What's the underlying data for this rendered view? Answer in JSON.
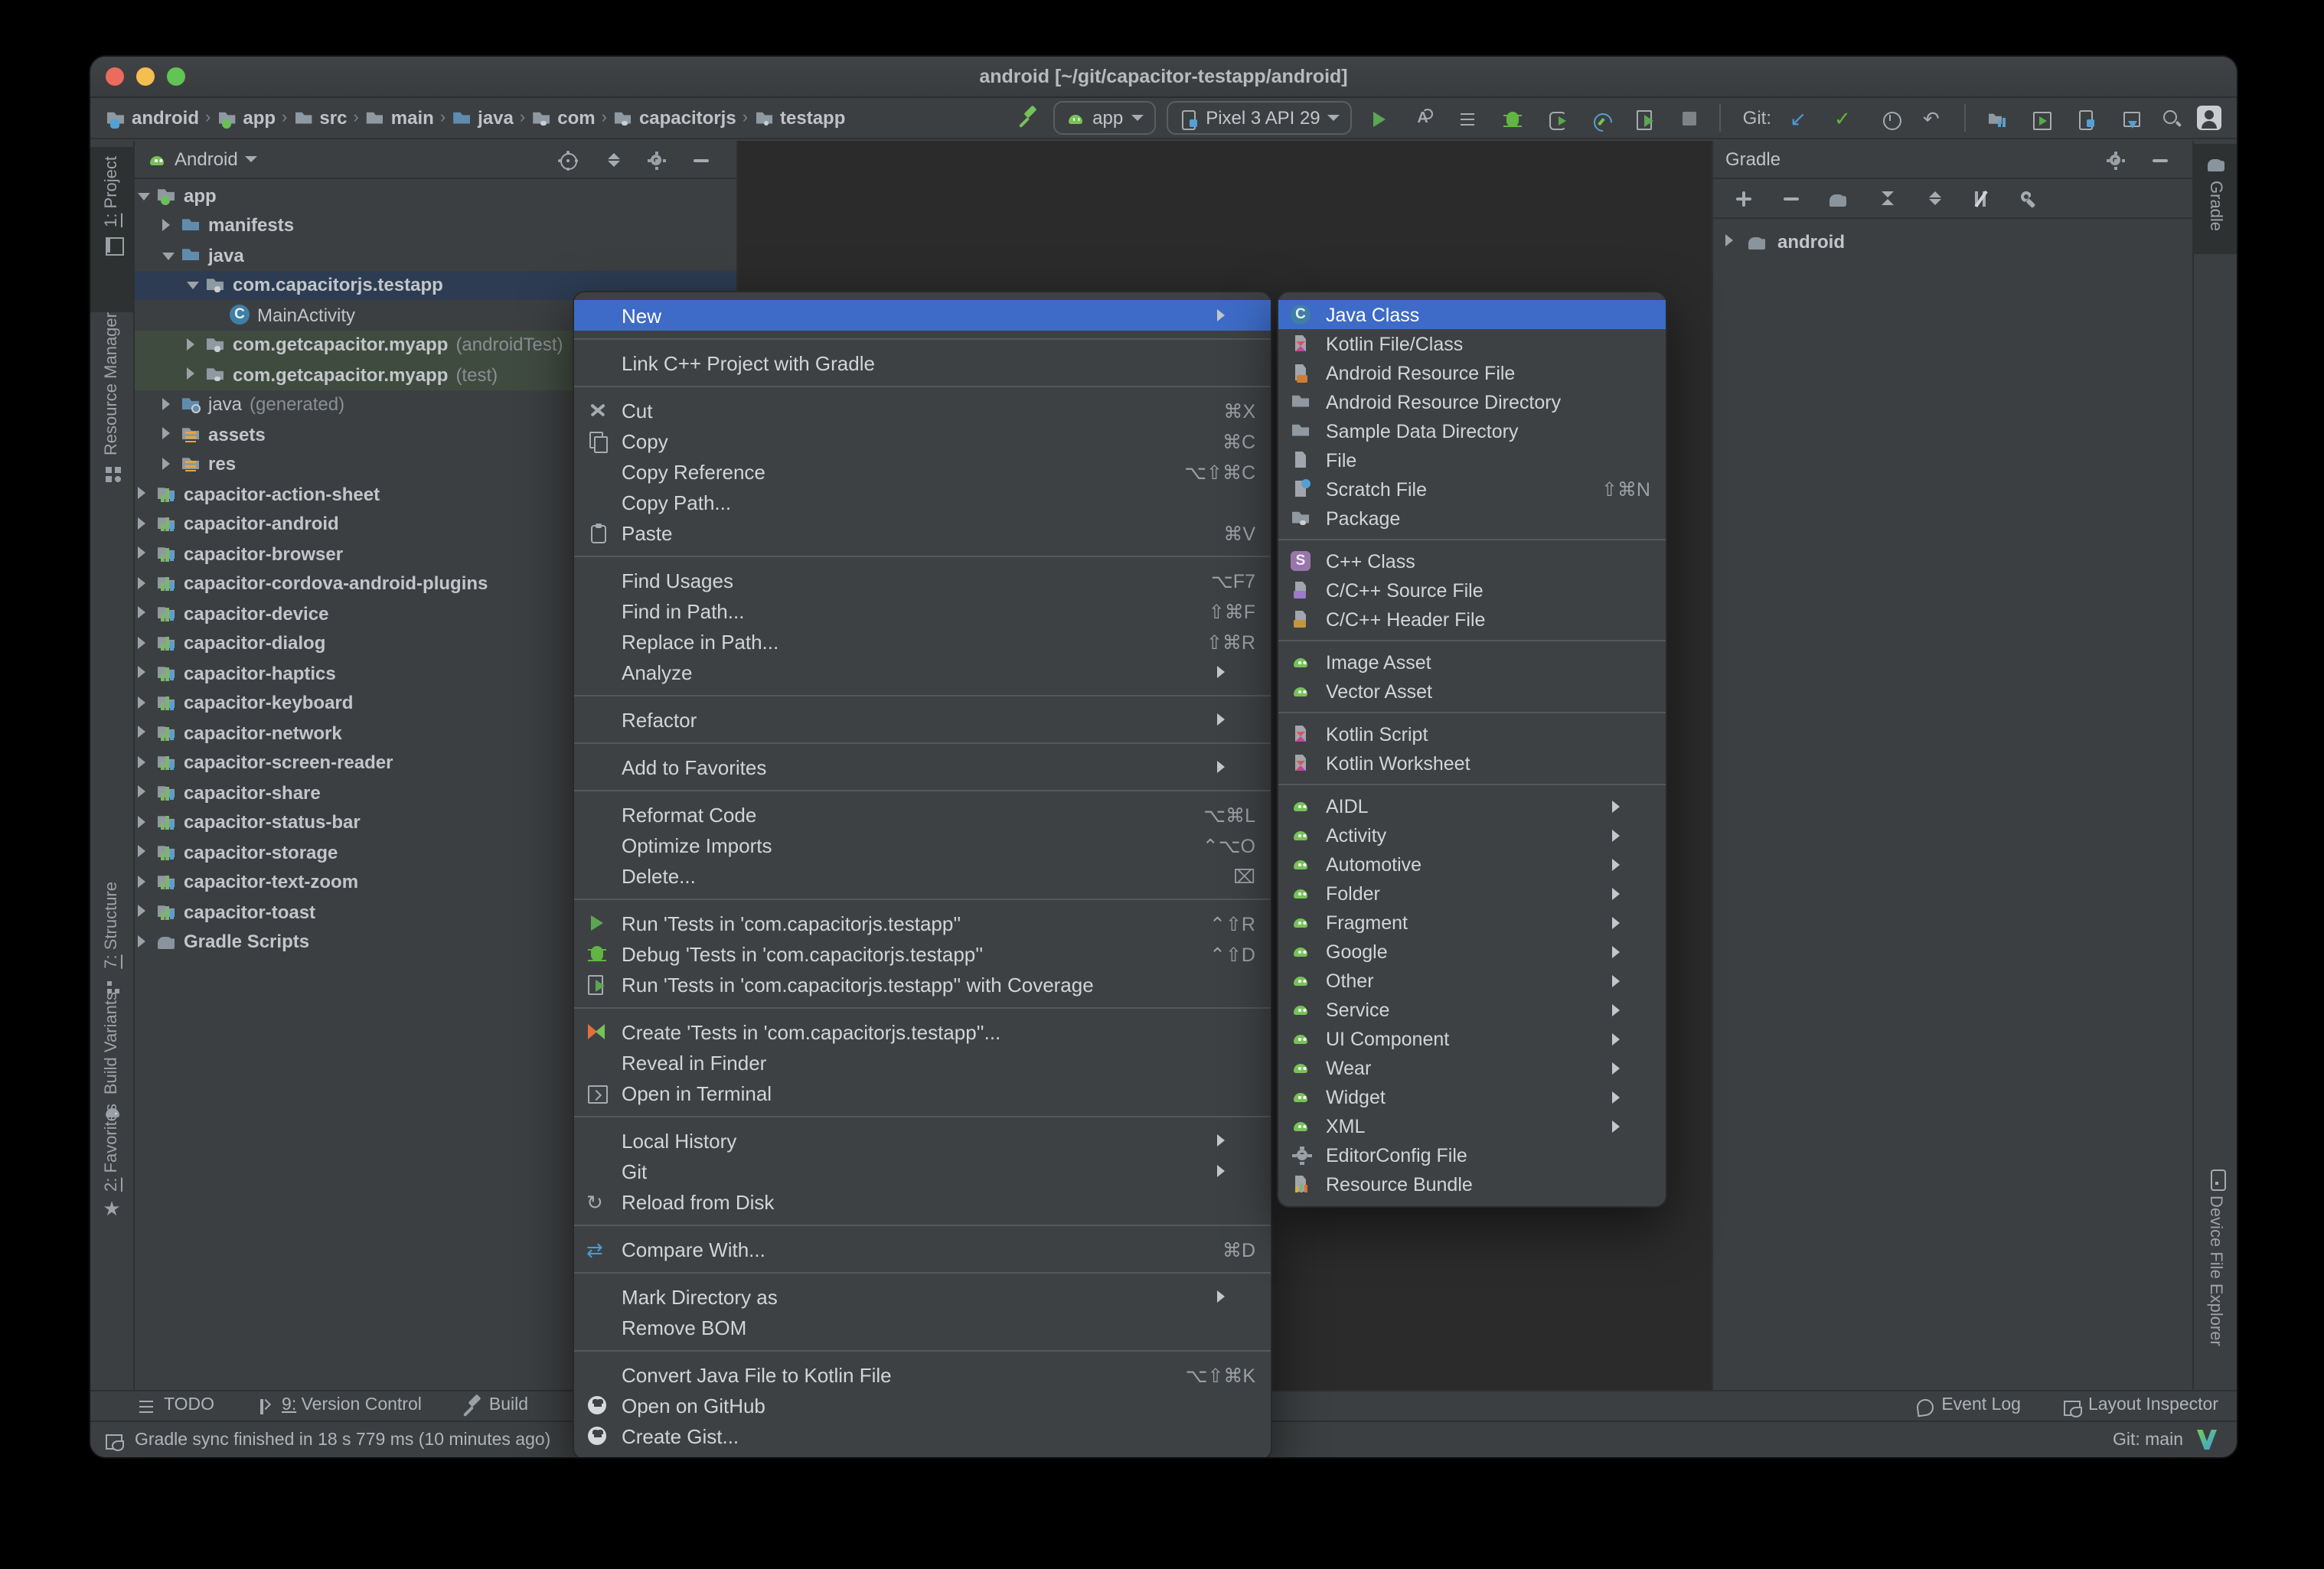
{
  "window": {
    "title": "android [~/git/capacitor-testapp/android]"
  },
  "accent_colors": {
    "selection_blue": "#3D6BC7",
    "tree_selection": "#2D3C53",
    "test_source_green": "#404B40",
    "run_green": "#5BA653",
    "android_green": "#77C159"
  },
  "toolbar": {
    "breadcrumbs": [
      {
        "label": "android",
        "icon": "android-folder"
      },
      {
        "label": "app",
        "icon": "app-folder"
      },
      {
        "label": "src",
        "icon": "folder"
      },
      {
        "label": "main",
        "icon": "folder"
      },
      {
        "label": "java",
        "icon": "fold-b"
      },
      {
        "label": "com",
        "icon": "pkg"
      },
      {
        "label": "capacitorjs",
        "icon": "pkg"
      },
      {
        "label": "testapp",
        "icon": "pkg"
      }
    ],
    "build_icon": "hammer",
    "run_config": {
      "label": "app",
      "icon": "android"
    },
    "device_selector": {
      "label": "Pixel 3 API 29",
      "icon": "devmgr"
    },
    "run_icons": [
      "play",
      "applyA",
      "list",
      "bug",
      "attach",
      "profiler",
      "coverage",
      "stop"
    ],
    "git_label": "Git:",
    "git_icons": [
      "arrow-dl",
      "check",
      "clockme",
      "undo"
    ],
    "tool_icons": [
      "syncfold",
      "runwin",
      "devmgr",
      "sdk"
    ],
    "search_icon": "search",
    "avatar_icon": "avatar"
  },
  "left_stripe": {
    "top": [
      {
        "label": "1: Project",
        "icon": "window",
        "mnemonic": true,
        "active": true
      },
      {
        "label": "Resource Manager",
        "icon": "resmgr",
        "mnemonic": false,
        "active": false
      }
    ],
    "bottom": [
      {
        "label": "7: Structure",
        "icon": "structure",
        "mnemonic": true,
        "active": false
      },
      {
        "label": "Build Variants",
        "icon": "android-gray",
        "mnemonic": false,
        "active": false
      },
      {
        "label": "2: Favorites",
        "icon": "star",
        "mnemonic": true,
        "active": false
      }
    ]
  },
  "right_stripe": {
    "top": [
      {
        "label": "Gradle",
        "icon": "elephant",
        "active": true
      }
    ],
    "bottom": [
      {
        "label": "Device File Explorer",
        "icon": "phone",
        "active": false
      }
    ]
  },
  "project_panel": {
    "mode": "Android",
    "header_icons": [
      "locate",
      "collapseall",
      "gearme",
      "minusme"
    ],
    "tree": [
      {
        "label": "app",
        "icon": "app-folder",
        "level": 0,
        "arrow": "exp",
        "bold": true
      },
      {
        "label": "manifests",
        "icon": "fold-b",
        "level": 1,
        "arrow": "col",
        "bold": true
      },
      {
        "label": "java",
        "icon": "fold-b",
        "level": 1,
        "arrow": "exp",
        "bold": true
      },
      {
        "label": "com.capacitorjs.testapp",
        "icon": "pkg",
        "level": 2,
        "arrow": "exp",
        "bold": true,
        "state": "selected"
      },
      {
        "label": "MainActivity",
        "icon": "class",
        "level": 3,
        "arrow": "none",
        "bold": false
      },
      {
        "label": "com.getcapacitor.myapp",
        "suffix": "(androidTest)",
        "icon": "pkg",
        "level": 2,
        "arrow": "col",
        "bold": true,
        "state": "green"
      },
      {
        "label": "com.getcapacitor.myapp",
        "suffix": "(test)",
        "icon": "pkg",
        "level": 2,
        "arrow": "col",
        "bold": true,
        "state": "green"
      },
      {
        "label": "java",
        "suffix": "(generated)",
        "icon": "folder-gen",
        "level": 1,
        "arrow": "col",
        "bold": false
      },
      {
        "label": "assets",
        "icon": "folder-res",
        "level": 1,
        "arrow": "col",
        "bold": true
      },
      {
        "label": "res",
        "icon": "folder-res",
        "level": 1,
        "arrow": "col",
        "bold": true
      },
      {
        "label": "capacitor-action-sheet",
        "icon": "module",
        "level": 0,
        "arrow": "col",
        "bold": true
      },
      {
        "label": "capacitor-android",
        "icon": "module",
        "level": 0,
        "arrow": "col",
        "bold": true
      },
      {
        "label": "capacitor-browser",
        "icon": "module",
        "level": 0,
        "arrow": "col",
        "bold": true
      },
      {
        "label": "capacitor-cordova-android-plugins",
        "icon": "module",
        "level": 0,
        "arrow": "col",
        "bold": true
      },
      {
        "label": "capacitor-device",
        "icon": "module",
        "level": 0,
        "arrow": "col",
        "bold": true
      },
      {
        "label": "capacitor-dialog",
        "icon": "module",
        "level": 0,
        "arrow": "col",
        "bold": true
      },
      {
        "label": "capacitor-haptics",
        "icon": "module",
        "level": 0,
        "arrow": "col",
        "bold": true
      },
      {
        "label": "capacitor-keyboard",
        "icon": "module",
        "level": 0,
        "arrow": "col",
        "bold": true
      },
      {
        "label": "capacitor-network",
        "icon": "module",
        "level": 0,
        "arrow": "col",
        "bold": true
      },
      {
        "label": "capacitor-screen-reader",
        "icon": "module",
        "level": 0,
        "arrow": "col",
        "bold": true
      },
      {
        "label": "capacitor-share",
        "icon": "module",
        "level": 0,
        "arrow": "col",
        "bold": true
      },
      {
        "label": "capacitor-status-bar",
        "icon": "module",
        "level": 0,
        "arrow": "col",
        "bold": true
      },
      {
        "label": "capacitor-storage",
        "icon": "module",
        "level": 0,
        "arrow": "col",
        "bold": true
      },
      {
        "label": "capacitor-text-zoom",
        "icon": "module",
        "level": 0,
        "arrow": "col",
        "bold": true
      },
      {
        "label": "capacitor-toast",
        "icon": "module",
        "level": 0,
        "arrow": "col",
        "bold": true
      },
      {
        "label": "Gradle Scripts",
        "icon": "elephant",
        "level": 0,
        "arrow": "col",
        "bold": true
      }
    ]
  },
  "gradle_panel": {
    "title": "Gradle",
    "header_icons": [
      "gearme",
      "minusme"
    ],
    "toolbar_icons": [
      "plusme",
      "minusme",
      "elephant",
      "expandall",
      "collapseall",
      "offline",
      "wrench"
    ],
    "tree": [
      {
        "label": "android",
        "icon": "elephant",
        "arrow": "col",
        "bold": true
      }
    ]
  },
  "context_menu": {
    "items": [
      {
        "label": "New",
        "selected": true,
        "arrow": true
      },
      {
        "sep": true
      },
      {
        "label": "Link C++ Project with Gradle"
      },
      {
        "sep": true
      },
      {
        "label": "Cut",
        "icon": "scissors",
        "shortcut": "⌘X"
      },
      {
        "label": "Copy",
        "icon": "copy",
        "shortcut": "⌘C"
      },
      {
        "label": "Copy Reference",
        "shortcut": "⌥⇧⌘C"
      },
      {
        "label": "Copy Path..."
      },
      {
        "label": "Paste",
        "icon": "paste",
        "shortcut": "⌘V"
      },
      {
        "sep": true
      },
      {
        "label": "Find Usages",
        "shortcut": "⌥F7"
      },
      {
        "label": "Find in Path...",
        "shortcut": "⇧⌘F"
      },
      {
        "label": "Replace in Path...",
        "shortcut": "⇧⌘R"
      },
      {
        "label": "Analyze",
        "arrow": true
      },
      {
        "sep": true
      },
      {
        "label": "Refactor",
        "arrow": true
      },
      {
        "sep": true
      },
      {
        "label": "Add to Favorites",
        "arrow": true
      },
      {
        "sep": true
      },
      {
        "label": "Reformat Code",
        "shortcut": "⌥⌘L"
      },
      {
        "label": "Optimize Imports",
        "shortcut": "⌃⌥O"
      },
      {
        "label": "Delete...",
        "shortcut": "⌧"
      },
      {
        "sep": true
      },
      {
        "label": "Run 'Tests in 'com.capacitorjs.testapp''",
        "icon": "play",
        "shortcut": "⌃⇧R"
      },
      {
        "label": "Debug 'Tests in 'com.capacitorjs.testapp''",
        "icon": "bug",
        "shortcut": "⌃⇧D"
      },
      {
        "label": "Run 'Tests in 'com.capacitorjs.testapp'' with Coverage",
        "icon": "coverage"
      },
      {
        "sep": true
      },
      {
        "label": "Create 'Tests in 'com.capacitorjs.testapp''...",
        "icon": "tests"
      },
      {
        "label": "Reveal in Finder"
      },
      {
        "label": "Open in Terminal",
        "icon": "terminal"
      },
      {
        "sep": true
      },
      {
        "label": "Local History",
        "arrow": true
      },
      {
        "label": "Git",
        "arrow": true
      },
      {
        "label": "Reload from Disk",
        "icon": "reload-glyph"
      },
      {
        "sep": true
      },
      {
        "label": "Compare With...",
        "icon": "compare-glyph",
        "shortcut": "⌘D"
      },
      {
        "sep": true
      },
      {
        "label": "Mark Directory as",
        "arrow": true
      },
      {
        "label": "Remove BOM"
      },
      {
        "sep": true
      },
      {
        "label": "Convert Java File to Kotlin File",
        "shortcut": "⌥⇧⌘K"
      },
      {
        "label": "Open on GitHub",
        "icon": "github"
      },
      {
        "label": "Create Gist...",
        "icon": "github"
      }
    ]
  },
  "new_submenu": {
    "items": [
      {
        "label": "Java Class",
        "icon": "class",
        "selected": true
      },
      {
        "label": "Kotlin File/Class",
        "icon": "kotlin"
      },
      {
        "label": "Android Resource File",
        "icon": "android-file"
      },
      {
        "label": "Android Resource Directory",
        "icon": "folder"
      },
      {
        "label": "Sample Data Directory",
        "icon": "folder"
      },
      {
        "label": "File",
        "icon": "doc"
      },
      {
        "label": "Scratch File",
        "icon": "scratch",
        "shortcut": "⇧⌘N"
      },
      {
        "label": "Package",
        "icon": "pkg"
      },
      {
        "sep": true
      },
      {
        "label": "C++ Class",
        "icon": "cppclass"
      },
      {
        "label": "C/C++ Source File",
        "icon": "cppsrc"
      },
      {
        "label": "C/C++ Header File",
        "icon": "cpph"
      },
      {
        "sep": true
      },
      {
        "label": "Image Asset",
        "icon": "android"
      },
      {
        "label": "Vector Asset",
        "icon": "android"
      },
      {
        "sep": true
      },
      {
        "label": "Kotlin Script",
        "icon": "kotlin"
      },
      {
        "label": "Kotlin Worksheet",
        "icon": "kotlin"
      },
      {
        "sep": true
      },
      {
        "label": "AIDL",
        "icon": "android",
        "arrow": true
      },
      {
        "label": "Activity",
        "icon": "android",
        "arrow": true
      },
      {
        "label": "Automotive",
        "icon": "android",
        "arrow": true
      },
      {
        "label": "Folder",
        "icon": "android",
        "arrow": true
      },
      {
        "label": "Fragment",
        "icon": "android",
        "arrow": true
      },
      {
        "label": "Google",
        "icon": "android",
        "arrow": true
      },
      {
        "label": "Other",
        "icon": "android",
        "arrow": true
      },
      {
        "label": "Service",
        "icon": "android",
        "arrow": true
      },
      {
        "label": "UI Component",
        "icon": "android",
        "arrow": true
      },
      {
        "label": "Wear",
        "icon": "android",
        "arrow": true
      },
      {
        "label": "Widget",
        "icon": "android",
        "arrow": true
      },
      {
        "label": "XML",
        "icon": "android",
        "arrow": true
      },
      {
        "label": "EditorConfig File",
        "icon": "gearme"
      },
      {
        "label": "Resource Bundle",
        "icon": "bundle"
      }
    ]
  },
  "tool_window_bar": {
    "left": [
      {
        "label": "TODO",
        "icon": "list",
        "mnemonic": false
      },
      {
        "label": "9: Version Control",
        "icon": "branch",
        "mnemonic": true
      },
      {
        "label": "Build",
        "icon": "hammer-gray",
        "mnemonic": false
      }
    ],
    "right": [
      {
        "label": "Event Log",
        "icon": "balloon",
        "mnemonic": false
      },
      {
        "label": "Layout Inspector",
        "icon": "layout",
        "mnemonic": false
      }
    ]
  },
  "status_bar": {
    "message": "Gradle sync finished in 18 s 779 ms (10 minutes ago)",
    "message_icon": "layout",
    "git_branch": "Git: main",
    "git_logo": "vlogo"
  }
}
